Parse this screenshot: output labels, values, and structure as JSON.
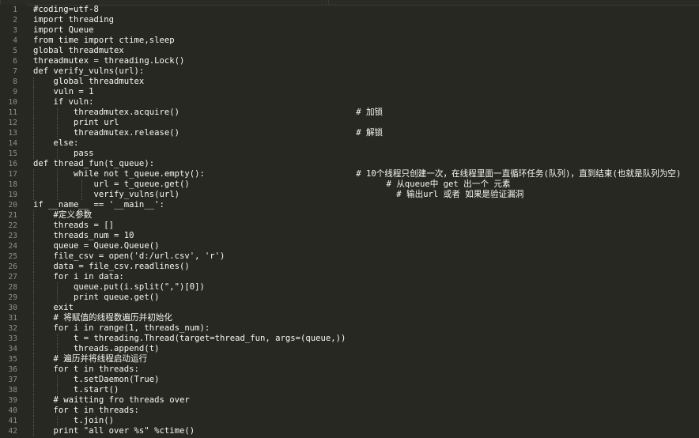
{
  "editor": {
    "lines": [
      {
        "n": "1",
        "indent": 0,
        "text": "#coding=utf-8"
      },
      {
        "n": "2",
        "indent": 0,
        "text": "import threading"
      },
      {
        "n": "3",
        "indent": 0,
        "text": "import Queue"
      },
      {
        "n": "4",
        "indent": 0,
        "text": "from time import ctime,sleep"
      },
      {
        "n": "5",
        "indent": 0,
        "text": "global threadmutex"
      },
      {
        "n": "6",
        "indent": 0,
        "text": "threadmutex = threading.Lock()"
      },
      {
        "n": "7",
        "indent": 0,
        "text": "def verify_vulns(url):"
      },
      {
        "n": "8",
        "indent": 1,
        "text": "    global threadmutex"
      },
      {
        "n": "9",
        "indent": 1,
        "text": "    vuln = 1"
      },
      {
        "n": "10",
        "indent": 1,
        "text": "    if vuln:"
      },
      {
        "n": "11",
        "indent": 2,
        "text": "        threadmutex.acquire()                                   # 加锁"
      },
      {
        "n": "12",
        "indent": 2,
        "text": "        print url"
      },
      {
        "n": "13",
        "indent": 2,
        "text": "        threadmutex.release()                                   # 解锁"
      },
      {
        "n": "14",
        "indent": 1,
        "text": "    else:"
      },
      {
        "n": "15",
        "indent": 2,
        "text": "        pass"
      },
      {
        "n": "16",
        "indent": 0,
        "text": "def thread_fun(t_queue):"
      },
      {
        "n": "17",
        "indent": 2,
        "text": "        while not t_queue.empty():                              # 10个线程只创建一次，在线程里面一直循环任务(队列)，直到结束(也就是队列为空)"
      },
      {
        "n": "18",
        "indent": 3,
        "text": "            url = t_queue.get()                                       # 从queue中 get 出一个 元素"
      },
      {
        "n": "19",
        "indent": 3,
        "text": "            verify_vulns(url)                                           # 输出url 或者 如果是验证漏洞"
      },
      {
        "n": "20",
        "indent": 0,
        "text": "if __name__ == '__main__':"
      },
      {
        "n": "21",
        "indent": 1,
        "text": "    #定义参数"
      },
      {
        "n": "22",
        "indent": 1,
        "text": "    threads = []"
      },
      {
        "n": "23",
        "indent": 1,
        "text": "    threads_num = 10"
      },
      {
        "n": "24",
        "indent": 1,
        "text": "    queue = Queue.Queue()"
      },
      {
        "n": "25",
        "indent": 1,
        "text": "    file_csv = open('d:/url.csv', 'r')"
      },
      {
        "n": "26",
        "indent": 1,
        "text": "    data = file_csv.readlines()"
      },
      {
        "n": "27",
        "indent": 1,
        "text": "    for i in data:"
      },
      {
        "n": "28",
        "indent": 2,
        "text": "        queue.put(i.split(\",\")[0])"
      },
      {
        "n": "29",
        "indent": 2,
        "text": "        print queue.get()"
      },
      {
        "n": "30",
        "indent": 1,
        "text": "    exit"
      },
      {
        "n": "31",
        "indent": 1,
        "text": "    # 将赋值的线程数遍历并初始化"
      },
      {
        "n": "32",
        "indent": 1,
        "text": "    for i in range(1, threads_num):"
      },
      {
        "n": "33",
        "indent": 2,
        "text": "        t = threading.Thread(target=thread_fun, args=(queue,))"
      },
      {
        "n": "34",
        "indent": 2,
        "text": "        threads.append(t)"
      },
      {
        "n": "35",
        "indent": 1,
        "text": "    # 遍历并将线程启动运行"
      },
      {
        "n": "36",
        "indent": 1,
        "text": "    for t in threads:"
      },
      {
        "n": "37",
        "indent": 2,
        "text": "        t.setDaemon(True)"
      },
      {
        "n": "38",
        "indent": 2,
        "text": "        t.start()"
      },
      {
        "n": "39",
        "indent": 1,
        "text": "    # waitting fro threads over"
      },
      {
        "n": "40",
        "indent": 1,
        "text": "    for t in threads:"
      },
      {
        "n": "41",
        "indent": 2,
        "text": "        t.join()"
      },
      {
        "n": "42",
        "indent": 1,
        "text": "    print \"all over %s\" %ctime()"
      }
    ]
  },
  "colors": {
    "background": "#272822",
    "foreground": "#f8f8f2",
    "line_number": "#8f908a"
  }
}
